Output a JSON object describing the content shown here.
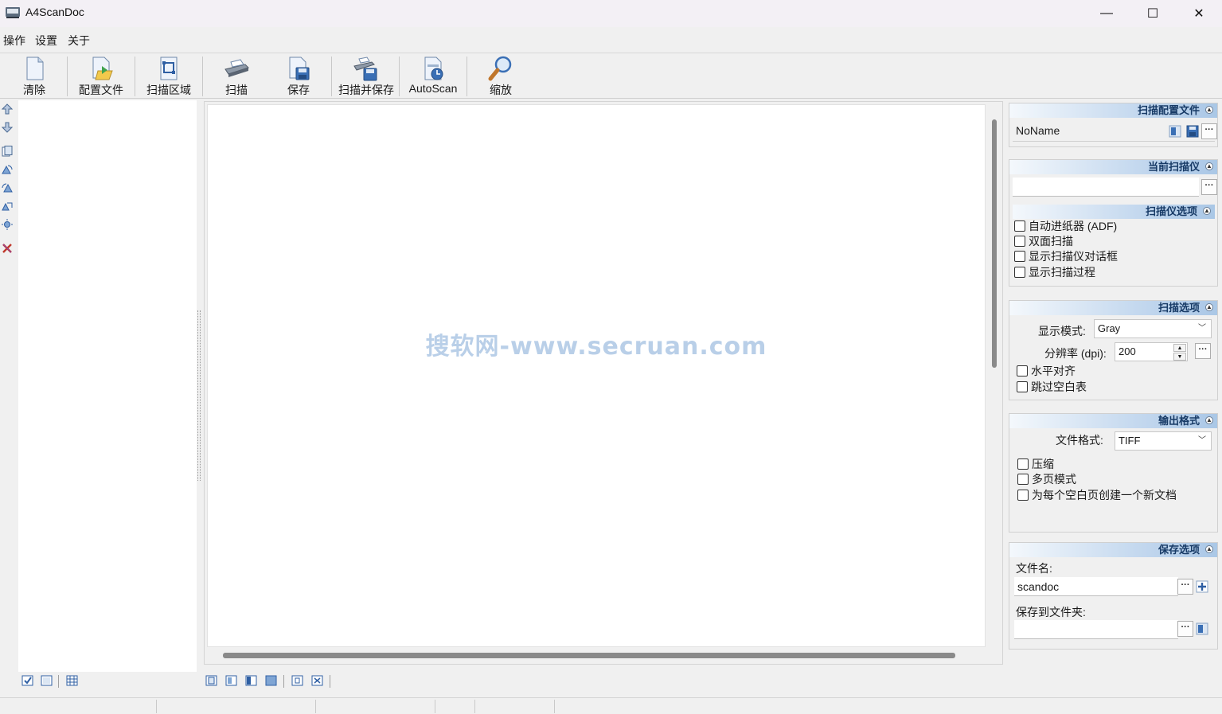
{
  "window": {
    "title": "A4ScanDoc",
    "minimize_symbol": "—",
    "maximize_symbol": "☐",
    "close_symbol": "✕"
  },
  "menu": {
    "items": [
      {
        "label": "操作"
      },
      {
        "label": "设置"
      },
      {
        "label": "关于"
      }
    ]
  },
  "toolbar": {
    "buttons": [
      {
        "label": "清除",
        "icon": "blank-page-icon"
      },
      {
        "label": "配置文件",
        "icon": "profile-folder-icon"
      },
      {
        "label": "扫描区域",
        "icon": "scan-area-icon"
      },
      {
        "label": "扫描",
        "icon": "scanner-icon"
      },
      {
        "label": "保存",
        "icon": "save-icon"
      },
      {
        "label": "扫描并保存",
        "icon": "scan-and-save-icon"
      },
      {
        "label": "AutoScan",
        "icon": "autoscan-icon"
      },
      {
        "label": "缩放",
        "icon": "zoom-icon"
      }
    ]
  },
  "canvas": {
    "watermark": "搜软网-www.secruan.com"
  },
  "panels": {
    "profile": {
      "title": "扫描配置文件",
      "collapse_symbol": "▲",
      "value": "NoName",
      "more_label": "···"
    },
    "scanner": {
      "title": "当前扫描仪",
      "collapse_symbol": "▲",
      "value": "",
      "more_label": "···"
    },
    "scanner_options": {
      "title": "扫描仪选项",
      "collapse_symbol": "▲",
      "checkboxes": [
        {
          "label": "自动进纸器 (ADF)"
        },
        {
          "label": "双面扫描"
        },
        {
          "label": "显示扫描仪对话框"
        },
        {
          "label": "显示扫描过程"
        }
      ]
    },
    "scan_options": {
      "title": "扫描选项",
      "collapse_symbol": "▲",
      "display_mode_label": "显示模式:",
      "display_mode_value": "Gray",
      "resolution_label": "分辨率 (dpi):",
      "resolution_value": "200",
      "more_label": "···",
      "checkboxes": [
        {
          "label": "水平对齐"
        },
        {
          "label": "跳过空白表"
        }
      ]
    },
    "output_format": {
      "title": "输出格式",
      "collapse_symbol": "▲",
      "file_format_label": "文件格式:",
      "file_format_value": "TIFF",
      "checkboxes": [
        {
          "label": "压缩"
        },
        {
          "label": "多页模式"
        },
        {
          "label": "为每个空白页创建一个新文档"
        }
      ]
    },
    "save_options": {
      "title": "保存选项",
      "collapse_symbol": "▲",
      "filename_label": "文件名:",
      "filename_value": "scandoc",
      "folder_label": "保存到文件夹:",
      "folder_value": "",
      "more_label": "···"
    }
  },
  "colors": {
    "panel_header_start": "#f4f8fc",
    "panel_header_end": "#aac7e6",
    "panel_header_text": "#173a66",
    "watermark": "#b9cfe8",
    "accent_icon": "#3a6fb5"
  }
}
